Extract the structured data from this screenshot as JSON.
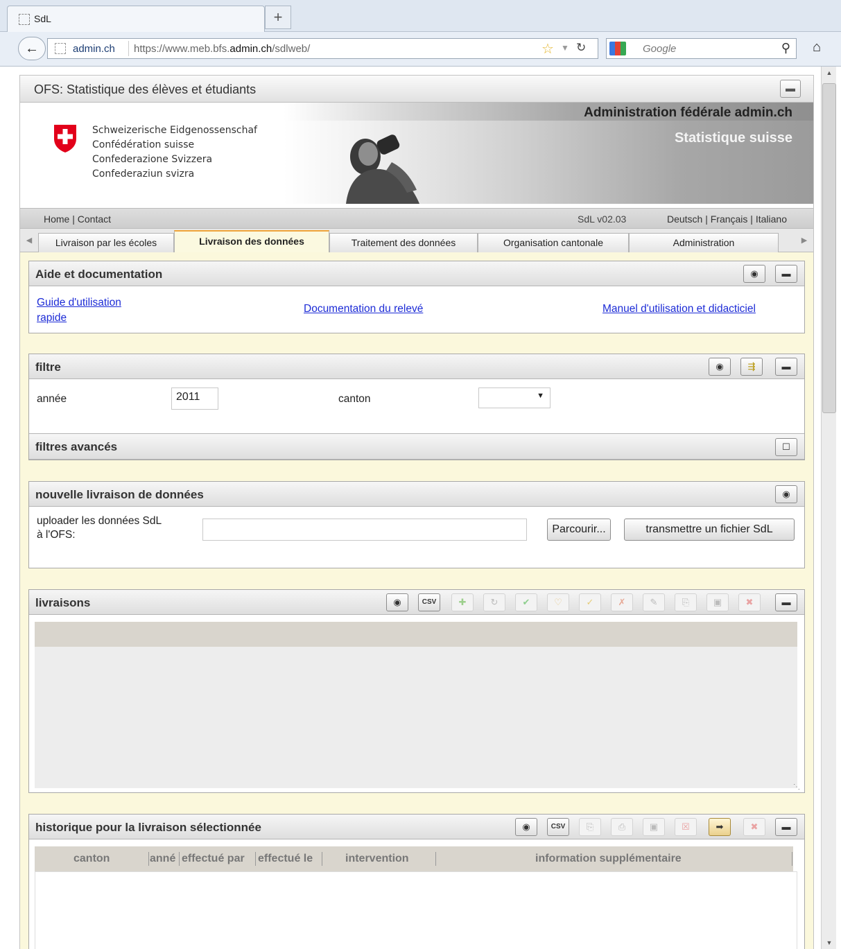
{
  "browser": {
    "tab_title": "SdL",
    "newtab_glyph": "+",
    "domain": "admin.ch",
    "url_prefix": "https://www.meb.bfs.",
    "url_host": "admin.ch",
    "url_path": "/sdlweb/",
    "search_placeholder": "Google"
  },
  "app": {
    "title": "OFS: Statistique des élèves et étudiants",
    "confederation": [
      "Schweizerische Eidgenossenschaf",
      "Confédération suisse",
      "Confederazione Svizzera",
      "Confederaziun svizra"
    ],
    "admin_title": "Administration fédérale admin.ch",
    "stat_suisse": "Statistique suisse",
    "menu": {
      "home": "Home",
      "contact": "Contact",
      "version": "SdL v02.03",
      "lang_de": "Deutsch",
      "lang_fr": "Français",
      "lang_it": "Italiano"
    },
    "tabs": [
      "Livraison par les écoles",
      "Livraison des données",
      "Traitement des données",
      "Organisation cantonale",
      "Administration"
    ]
  },
  "help": {
    "title": "Aide et documentation",
    "link_guide_1": "Guide d'utilisation",
    "link_guide_2": "rapide",
    "link_doc": "Documentation du relevé",
    "link_manual": "Manuel d'utilisation et didacticiel"
  },
  "filter": {
    "title": "filtre",
    "year_label": "année",
    "year_value": "2011",
    "canton_label": "canton",
    "canton_value": "",
    "advanced_title": "filtres avancés"
  },
  "upload": {
    "title": "nouvelle livraison de données",
    "label_1": "uploader les données SdL",
    "label_2": "à l'OFS:",
    "browse_label": "Parcourir...",
    "submit_label": "transmettre un fichier SdL"
  },
  "livraisons": {
    "title": "livraisons"
  },
  "history": {
    "title": "historique pour la livraison sélectionnée",
    "columns": [
      "canton",
      "anné",
      "effectué par",
      "effectué le",
      "intervention",
      "information supplémentaire"
    ]
  }
}
